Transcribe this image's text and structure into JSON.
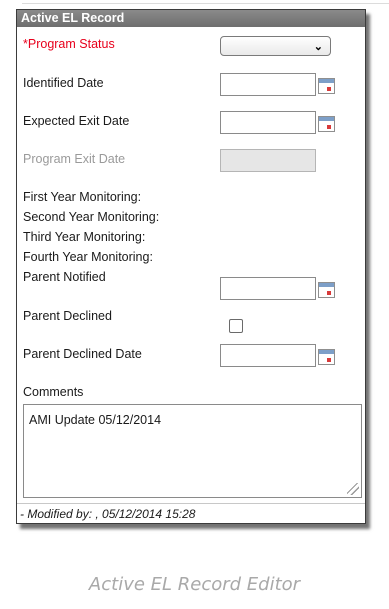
{
  "panel": {
    "title": "Active EL Record",
    "fields": {
      "program_status": {
        "label": "*Program Status",
        "value": ""
      },
      "identified_date": {
        "label": "Identified Date",
        "value": ""
      },
      "expected_exit_date": {
        "label": "Expected Exit Date",
        "value": ""
      },
      "program_exit_date": {
        "label": "Program Exit Date",
        "value": ""
      },
      "first_year_monitoring": {
        "label": "First Year Monitoring:"
      },
      "second_year_monitoring": {
        "label": "Second Year Monitoring:"
      },
      "third_year_monitoring": {
        "label": "Third Year Monitoring:"
      },
      "fourth_year_monitoring": {
        "label": "Fourth Year Monitoring:"
      },
      "parent_notified": {
        "label": "Parent Notified",
        "value": ""
      },
      "parent_declined": {
        "label": "Parent Declined",
        "checked": false
      },
      "parent_declined_date": {
        "label": "Parent Declined Date",
        "value": ""
      },
      "comments": {
        "label": "Comments",
        "value": "AMI Update 05/12/2014"
      }
    },
    "footer": "- Modified by: , 05/12/2014 15:28"
  },
  "caption": "Active EL Record Editor",
  "icons": {
    "calendar": "calendar-icon",
    "dropdown": "chevron-down-icon",
    "resize": "resize-grip-icon"
  }
}
